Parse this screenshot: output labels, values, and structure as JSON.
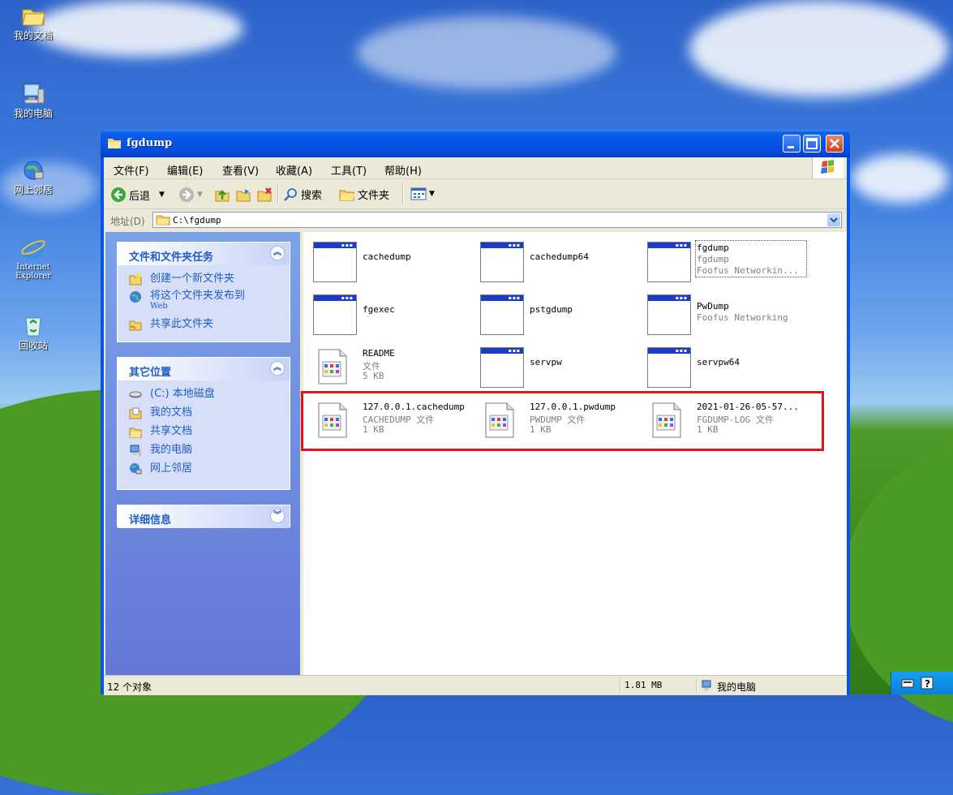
{
  "desktop": {
    "icons": [
      {
        "label": "我的文档"
      },
      {
        "label": "我的电脑"
      },
      {
        "label": "网上邻居"
      },
      {
        "label_line1": "Internet",
        "label_line2": "Explorer"
      },
      {
        "label": "回收站"
      }
    ]
  },
  "window": {
    "title": "fgdump",
    "menu": [
      "文件(F)",
      "编辑(E)",
      "查看(V)",
      "收藏(A)",
      "工具(T)",
      "帮助(H)"
    ],
    "toolbar": {
      "back": "后退",
      "search": "搜索",
      "folders": "文件夹"
    },
    "address": {
      "label": "地址(D)",
      "value": "C:\\fgdump"
    },
    "taskpane": {
      "file_tasks": {
        "title": "文件和文件夹任务",
        "items": [
          "创建一个新文件夹",
          "将这个文件夹发布到",
          "共享此文件夹"
        ],
        "item2_sub": "Web"
      },
      "other_places": {
        "title": "其它位置",
        "items": [
          "(C:) 本地磁盘",
          "我的文档",
          "共享文档",
          "我的电脑",
          "网上邻居"
        ]
      },
      "details": {
        "title": "详细信息"
      }
    },
    "files": [
      {
        "name": "cachedump",
        "type": "app"
      },
      {
        "name": "cachedump64",
        "type": "app"
      },
      {
        "name": "fgdump",
        "line2": "fgdump",
        "line3": "Foofus Networkin...",
        "type": "app"
      },
      {
        "name": "fgexec",
        "type": "app"
      },
      {
        "name": "pstgdump",
        "type": "app"
      },
      {
        "name": "PwDump",
        "line2": "Foofus Networking",
        "type": "app"
      },
      {
        "name": "README",
        "line2": "文件",
        "line3": "5 KB",
        "type": "doc"
      },
      {
        "name": "servpw",
        "type": "app"
      },
      {
        "name": "servpw64",
        "type": "app"
      },
      {
        "name": "127.0.0.1.cachedump",
        "line2": "CACHEDUMP 文件",
        "line3": "1 KB",
        "type": "doc"
      },
      {
        "name": "127.0.0.1.pwdump",
        "line2": "PWDUMP 文件",
        "line3": "1 KB",
        "type": "doc"
      },
      {
        "name": "2021-01-26-05-57...",
        "line2": "FGDUMP-LOG 文件",
        "line3": "1 KB",
        "type": "doc"
      }
    ],
    "status": {
      "count": "12 个对象",
      "size": "1.81 MB",
      "location": "我的电脑"
    }
  },
  "colors": {
    "titlebar": "#0554e4",
    "taskpane_link": "#215dc6",
    "highlight_border": "#e0141a"
  }
}
